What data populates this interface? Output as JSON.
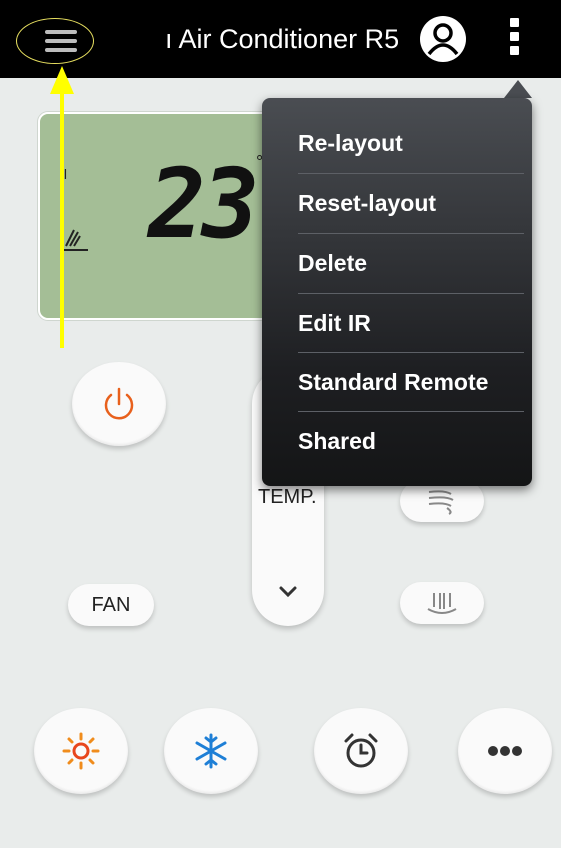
{
  "topbar": {
    "title": "ı Air Conditioner R5"
  },
  "display": {
    "temperature": "23",
    "degree_symbol": "°"
  },
  "controls": {
    "fan_label": "FAN",
    "temp_label": "TEMP."
  },
  "menu": {
    "items": [
      {
        "label": "Re-layout"
      },
      {
        "label": "Reset-layout"
      },
      {
        "label": "Delete"
      },
      {
        "label": "Edit IR"
      },
      {
        "label": "Standard Remote"
      },
      {
        "label": "Shared"
      }
    ]
  },
  "colors": {
    "accent_arrow": "#ffff00",
    "lcd_background": "#a4be96",
    "power_icon": "#e8601c",
    "heat_icon": "#e8461c",
    "cool_icon": "#1e7fd6"
  },
  "icons": {
    "menu": "hamburger-icon",
    "user": "user-icon",
    "overflow": "more-vertical-icon",
    "power": "power-icon",
    "swing_vertical": "swing-vertical-icon",
    "swing_horizontal": "swing-horizontal-icon",
    "down": "chevron-down-icon",
    "heat": "sun-icon",
    "cool": "snowflake-icon",
    "timer": "alarm-clock-icon",
    "more": "more-horizontal-icon"
  }
}
